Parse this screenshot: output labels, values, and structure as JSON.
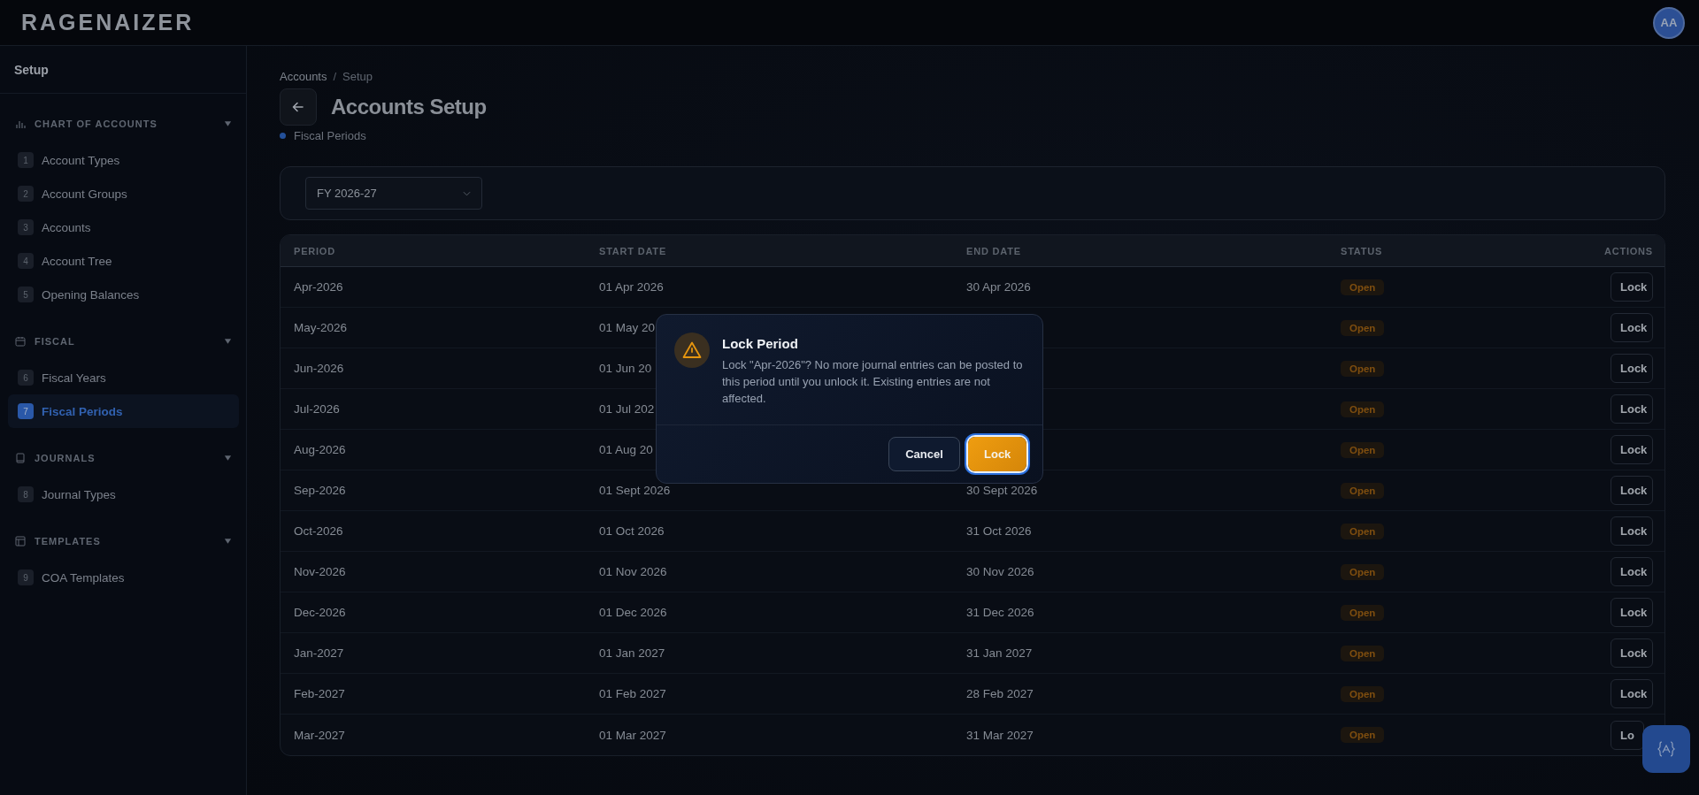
{
  "app": {
    "logo": "RAGENAIZER",
    "avatar": "AA"
  },
  "sidebar": {
    "title": "Setup",
    "sections": [
      {
        "label": "CHART OF ACCOUNTS",
        "expanded": true,
        "items": [
          {
            "number": "1",
            "label": "Account Types",
            "selected": false
          },
          {
            "number": "2",
            "label": "Account Groups",
            "selected": false
          },
          {
            "number": "3",
            "label": "Accounts",
            "selected": false
          },
          {
            "number": "4",
            "label": "Account Tree",
            "selected": false
          },
          {
            "number": "5",
            "label": "Opening Balances",
            "selected": false
          }
        ]
      },
      {
        "label": "FISCAL",
        "expanded": true,
        "items": [
          {
            "number": "6",
            "label": "Fiscal Years",
            "selected": false
          },
          {
            "number": "7",
            "label": "Fiscal Periods",
            "selected": true
          }
        ]
      },
      {
        "label": "JOURNALS",
        "expanded": true,
        "items": [
          {
            "number": "8",
            "label": "Journal Types",
            "selected": false
          }
        ]
      },
      {
        "label": "TEMPLATES",
        "expanded": true,
        "items": [
          {
            "number": "9",
            "label": "COA Templates",
            "selected": false
          }
        ]
      }
    ]
  },
  "breadcrumb": {
    "items": [
      "Accounts",
      "Setup"
    ],
    "separator": "/"
  },
  "page": {
    "title": "Accounts Setup",
    "subtitle": "Fiscal Periods"
  },
  "filter": {
    "fiscal_year": "FY 2026-27"
  },
  "table": {
    "columns": [
      "PERIOD",
      "START DATE",
      "END DATE",
      "STATUS",
      "ACTIONS"
    ],
    "rows": [
      {
        "period": "Apr-2026",
        "start_date": "01 Apr 2026",
        "end_date": "30 Apr 2026",
        "status": "Open",
        "action": "Lock",
        "action_partial": false
      },
      {
        "period": "May-2026",
        "start_date": "01 May 20",
        "status": "Open",
        "action": "Lock",
        "action_partial": false
      },
      {
        "period": "Jun-2026",
        "start_date": "01 Jun 20",
        "status": "Open",
        "action": "Lock",
        "action_partial": false
      },
      {
        "period": "Jul-2026",
        "start_date": "01 Jul 202",
        "status": "Open",
        "action": "Lock",
        "action_partial": false
      },
      {
        "period": "Aug-2026",
        "start_date": "01 Aug 20",
        "status": "Open",
        "action": "Lock",
        "action_partial": false
      },
      {
        "period": "Sep-2026",
        "start_date": "01 Sept 2026",
        "end_date": "30 Sept 2026",
        "status": "Open",
        "action": "Lock",
        "action_partial": false
      },
      {
        "period": "Oct-2026",
        "start_date": "01 Oct 2026",
        "end_date": "31 Oct 2026",
        "status": "Open",
        "action": "Lock",
        "action_partial": false
      },
      {
        "period": "Nov-2026",
        "start_date": "01 Nov 2026",
        "end_date": "30 Nov 2026",
        "status": "Open",
        "action": "Lock",
        "action_partial": false
      },
      {
        "period": "Dec-2026",
        "start_date": "01 Dec 2026",
        "end_date": "31 Dec 2026",
        "status": "Open",
        "action": "Lock",
        "action_partial": false
      },
      {
        "period": "Jan-2027",
        "start_date": "01 Jan 2027",
        "end_date": "31 Jan 2027",
        "status": "Open",
        "action": "Lock",
        "action_partial": false
      },
      {
        "period": "Feb-2027",
        "start_date": "01 Feb 2027",
        "end_date": "28 Feb 2027",
        "status": "Open",
        "action": "Lock",
        "action_partial": false
      },
      {
        "period": "Mar-2027",
        "start_date": "01 Mar 2027",
        "end_date": "31 Mar 2027",
        "status": "Open",
        "action": "Lo",
        "action_partial": true
      }
    ]
  },
  "dialog": {
    "title": "Lock Period",
    "message": "Lock \"Apr-2026\"? No more journal entries can be posted to this period until you unlock it. Existing entries are not affected.",
    "buttons": [
      {
        "label": "Cancel",
        "kind": "secondary",
        "focused": false
      },
      {
        "label": "Lock",
        "kind": "primary",
        "focused": true
      }
    ]
  }
}
